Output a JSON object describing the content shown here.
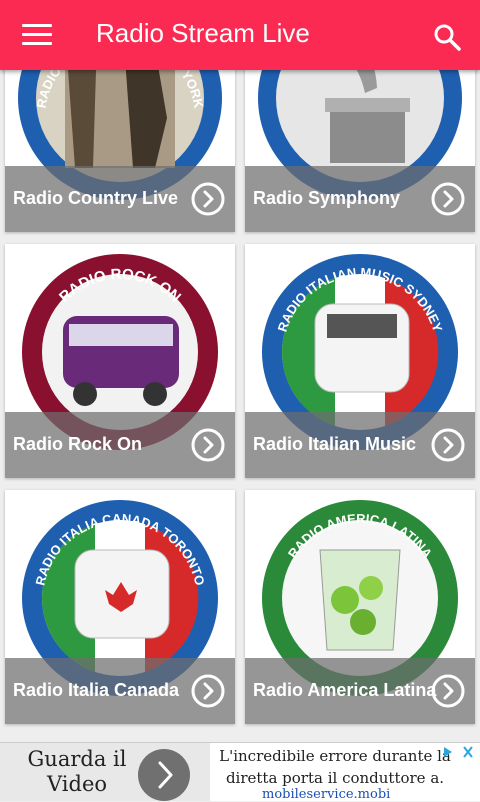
{
  "app": {
    "title": "Radio Stream Live"
  },
  "cards": [
    {
      "label": "Radio Country Live",
      "ring_text": "RADIO COUNTRY LIVE NEW YORK",
      "ring_color": "#1f5fb0",
      "theme": "country"
    },
    {
      "label": "Radio Symphony",
      "ring_text": "",
      "ring_color": "#1f5fb0",
      "theme": "symphony"
    },
    {
      "label": "Radio Rock On",
      "ring_text": "RADIO ROCK ON",
      "ring_color": "#8a1030",
      "theme": "rock"
    },
    {
      "label": "Radio Italian Music",
      "ring_text": "RADIO ITALIAN MUSIC SYDNEY",
      "ring_color": "#1f5fb0",
      "theme": "italian"
    },
    {
      "label": "Radio Italia Canada",
      "ring_text": "RADIO ITALIA CANADA TORONTO",
      "ring_color": "#1f5fb0",
      "theme": "canada"
    },
    {
      "label": "Radio America Latina",
      "ring_text": "RADIO AMERICA LATINA",
      "ring_color": "#2a8a3a",
      "theme": "latina"
    }
  ],
  "ad": {
    "cta": "Guarda il Video",
    "text": "L'incredibile errore durante la diretta porta il conduttore a.",
    "source": "mobileservice.mobi"
  },
  "colors": {
    "appbar": "#fb2a52",
    "caption_overlay": "#6e6e6e",
    "background": "#eeeeee"
  },
  "icons": {
    "menu": "menu-icon",
    "search": "search-icon",
    "go": "chevron-right-circle-icon",
    "ad_arrow": "chevron-right-icon",
    "adchoices": "adchoices-icon"
  }
}
